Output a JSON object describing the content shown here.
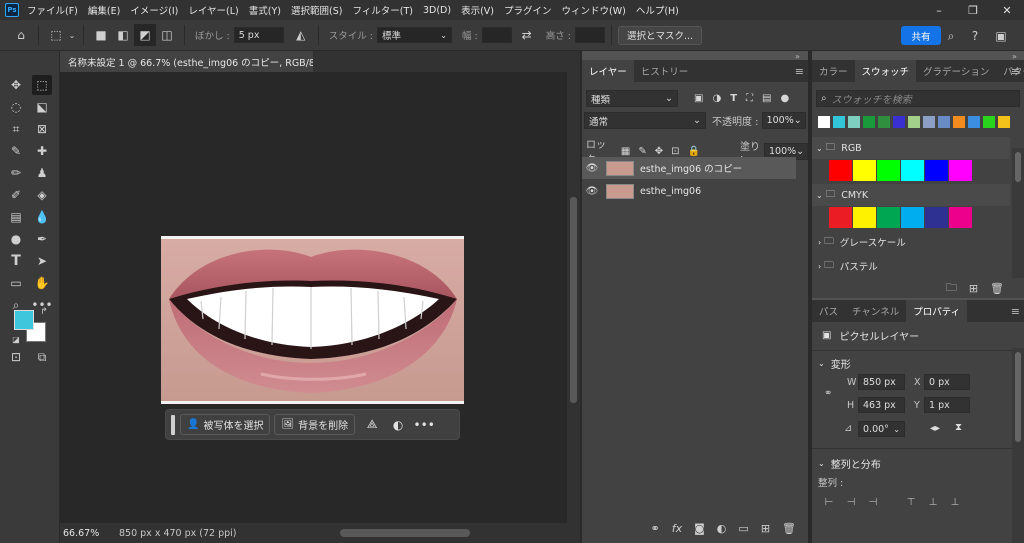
{
  "menu": {
    "logo": "Ps",
    "items": [
      "ファイル(F)",
      "編集(E)",
      "イメージ(I)",
      "レイヤー(L)",
      "書式(Y)",
      "選択範囲(S)",
      "フィルター(T)",
      "3D(D)",
      "表示(V)",
      "プラグイン",
      "ウィンドウ(W)",
      "ヘルプ(H)"
    ]
  },
  "options": {
    "feather_label": "ぼかし :",
    "feather_value": "5 px",
    "style_label": "スタイル :",
    "style_value": "標準",
    "width_label": "幅 :",
    "height_label": "高さ :",
    "select_mask_label": "選択とマスク...",
    "share_label": "共有"
  },
  "document": {
    "tab_title": "名称未設定 1 @ 66.7% (esthe_img06 のコピー, RGB/8) *",
    "tab_close": "×",
    "zoom": "66.67%",
    "doc_info": "850 px x 470 px (72 ppi)"
  },
  "context_bar": {
    "select_subject": "被写体を選択",
    "remove_background": "背景を削除",
    "more": "•••"
  },
  "layers_panel": {
    "tabs": [
      "レイヤー",
      "ヒストリー"
    ],
    "kind_filter": "種類",
    "blend_mode": "通常",
    "opacity_label": "不透明度 :",
    "opacity_value": "100%",
    "lock_label": "ロック :",
    "fill_label": "塗り :",
    "fill_value": "100%",
    "layers": [
      {
        "name": "esthe_img06 のコピー",
        "selected": true
      },
      {
        "name": "esthe_img06",
        "selected": false
      }
    ]
  },
  "swatches_panel": {
    "tabs": [
      "カラー",
      "スウォッチ",
      "グラデーション",
      "パターン"
    ],
    "search_placeholder": "スウォッチを検索",
    "recent_colors": [
      "#ffffff",
      "#33c6d8",
      "#7fcfc0",
      "#1a9a3a",
      "#2f8f3f",
      "#3a2fd0",
      "#a3d08a",
      "#8c9fc4",
      "#6a8cc6",
      "#f28c1e",
      "#3c8fe0",
      "#2ad61d",
      "#f2c21a"
    ],
    "groups": [
      {
        "name": "RGB",
        "colors": [
          "#ff0000",
          "#ffff00",
          "#00ff00",
          "#00ffff",
          "#0000ff",
          "#ff00ff"
        ]
      },
      {
        "name": "CMYK",
        "colors": [
          "#ec1c24",
          "#fff200",
          "#00a651",
          "#00aeef",
          "#2e3192",
          "#ec008c"
        ]
      },
      {
        "name": "グレースケール"
      },
      {
        "name": "パステル"
      }
    ]
  },
  "properties_panel": {
    "tabs": [
      "パス",
      "チャンネル",
      "プロパティ"
    ],
    "layer_type": "ピクセルレイヤー",
    "transform_label": "変形",
    "w_label": "W",
    "w_value": "850 px",
    "h_label": "H",
    "h_value": "463 px",
    "x_label": "X",
    "x_value": "0 px",
    "y_label": "Y",
    "y_value": "1 px",
    "angle_value": "0.00°",
    "align_label": "整列と分布",
    "align_sub": "整列 :"
  },
  "colors": {
    "foreground": "#3fc6dc",
    "background": "#ffffff",
    "accent": "#1473e6"
  }
}
